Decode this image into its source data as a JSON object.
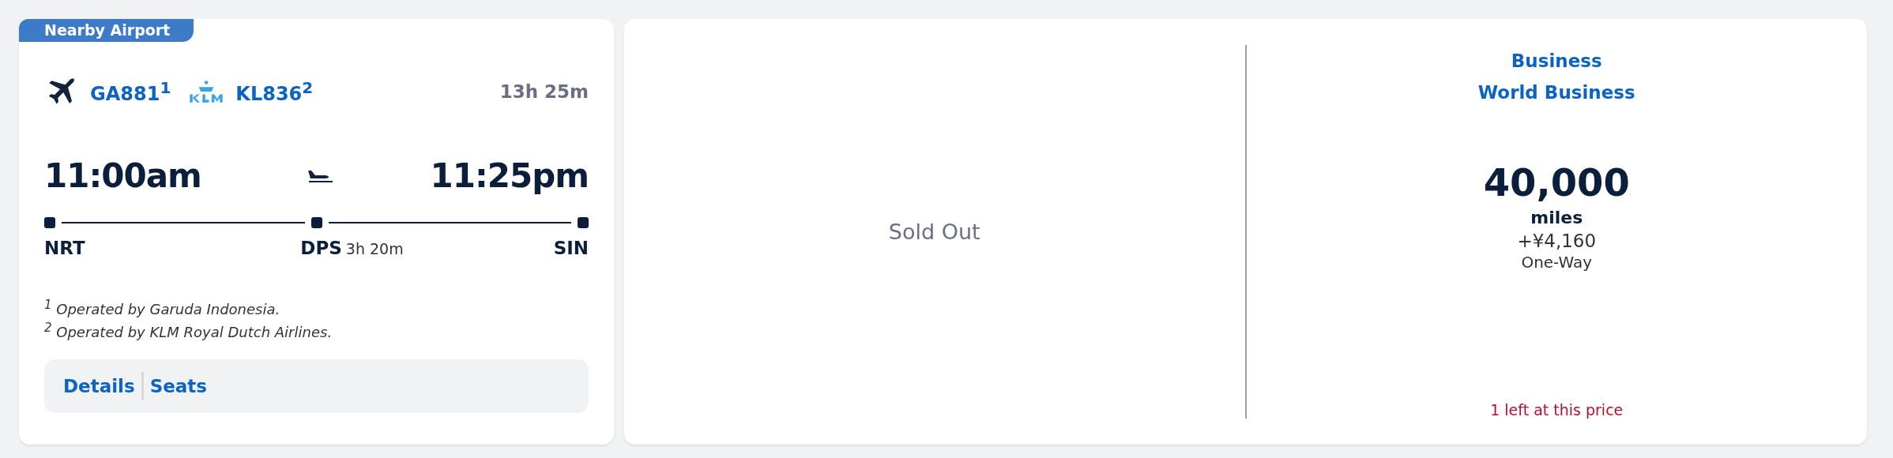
{
  "flight_card": {
    "badge": "Nearby Airport",
    "flights": [
      {
        "kind": "plane",
        "number": "GA881$^{1}$"
      },
      {
        "kind": "klm",
        "number": "KL836$^{2}$"
      }
    ],
    "duration": "13h 25m",
    "depart_time": "11:00am",
    "arrive_time": "11:25pm",
    "stops": [
      {
        "code": "NRT"
      },
      {
        "code": "DPS",
        "layover": "3h 20m"
      },
      {
        "code": "SIN"
      }
    ],
    "footnotes": [
      "$^{1}$ Operated by Garuda Indonesia.",
      "$^{2}$ Operated by KLM Royal Dutch Airlines."
    ],
    "links": [
      "Details",
      "Seats"
    ]
  },
  "fares": [
    {
      "kind": "sold_out",
      "label": "Sold Out"
    },
    {
      "kind": "price",
      "cabin": "Business",
      "product": "World Business",
      "miles": "40,000",
      "miles_unit": "miles",
      "taxes": "+¥4,160",
      "trip": "One-Way",
      "alert": "1 left at this price"
    }
  ]
}
